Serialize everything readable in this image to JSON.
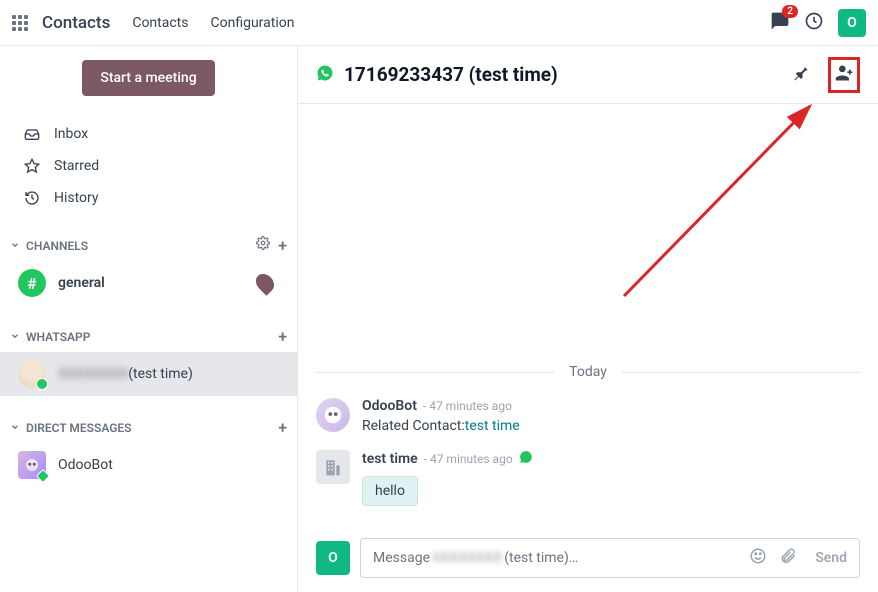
{
  "header": {
    "app_title": "Contacts",
    "nav": [
      "Contacts",
      "Configuration"
    ],
    "message_badge": "2",
    "user_initial": "O"
  },
  "sidebar": {
    "meeting_button": "Start a meeting",
    "items": [
      {
        "icon": "inbox-icon",
        "label": "Inbox"
      },
      {
        "icon": "star-icon",
        "label": "Starred"
      },
      {
        "icon": "history-icon",
        "label": "History"
      }
    ],
    "sections": {
      "channels": {
        "label": "CHANNELS",
        "items": [
          {
            "name": "general"
          }
        ]
      },
      "whatsapp": {
        "label": "WHATSAPP",
        "items": [
          {
            "name_hidden": "XXXXXXXX",
            "name_suffix": " (test time)"
          }
        ]
      },
      "direct_messages": {
        "label": "DIRECT MESSAGES",
        "items": [
          {
            "name": "OdooBot"
          }
        ]
      }
    }
  },
  "chat": {
    "title": "17169233437 (test time)",
    "divider": "Today",
    "messages": [
      {
        "author": "OdooBot",
        "time": "47 minutes ago",
        "text_prefix": "Related Contact:",
        "text_link": "test time",
        "type": "bot"
      },
      {
        "author": "test time",
        "time": "47 minutes ago",
        "bubble": "hello",
        "type": "contact"
      }
    ],
    "composer": {
      "avatar_initial": "O",
      "placeholder_prefix": "Message ",
      "placeholder_hidden": "XXXXXXXX",
      "placeholder_suffix": " (test time)…",
      "send_label": "Send"
    }
  }
}
